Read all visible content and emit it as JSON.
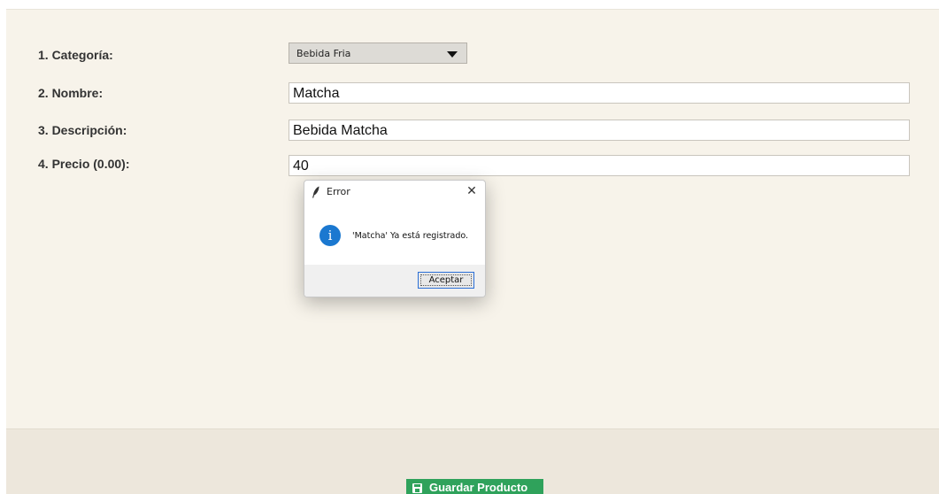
{
  "form": {
    "category_label": "1. Categoría:",
    "category_value": "Bebida Fria",
    "name_label": "2. Nombre:",
    "name_value": "Matcha",
    "description_label": "3. Descripción:",
    "description_value": "Bebida Matcha",
    "price_label": "4. Precio (0.00):",
    "price_value": "40"
  },
  "dialog": {
    "title": "Error",
    "close_glyph": "✕",
    "icon": "info-icon",
    "icon_glyph": "i",
    "message": "'Matcha' Ya está registrado.",
    "ok_label": "Aceptar"
  },
  "footer": {
    "save_label": "Guardar Producto",
    "save_icon": "floppy-disk-icon"
  },
  "colors": {
    "form_background": "#f7f3ea",
    "footer_background": "#ede7dc",
    "save_button": "#2fa25b",
    "info_icon": "#1b78d0"
  }
}
